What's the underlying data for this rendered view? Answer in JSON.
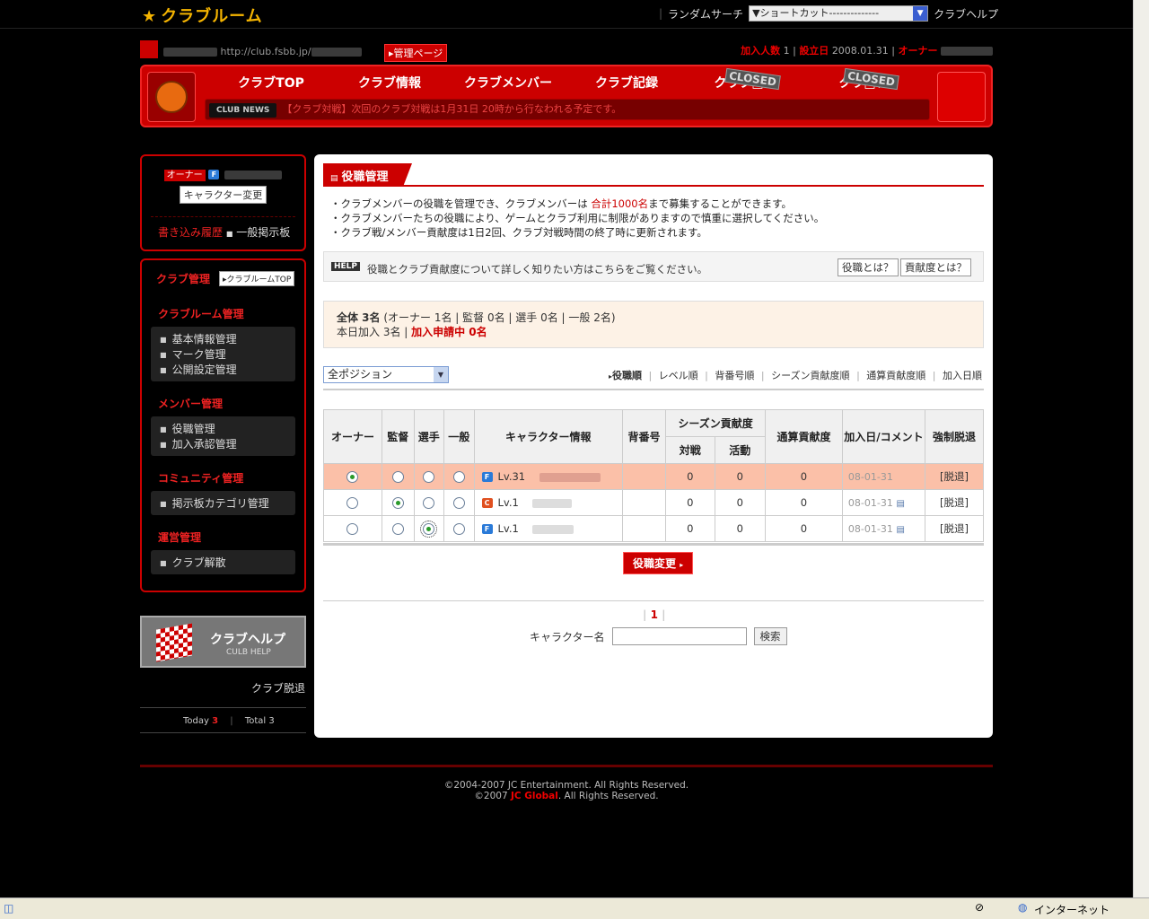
{
  "header": {
    "logo": "クラブルーム",
    "random_search": "ランダムサーチ",
    "shortcut": "▼ショートカット--------------",
    "club_help": "クラブヘルプ"
  },
  "club": {
    "url": "http://club.fsbb.jp/",
    "admin_page": "管理ページ",
    "members_label": "加入人数",
    "members": "1",
    "founded_label": "設立日",
    "founded": "2008.01.31",
    "owner_label": "オーナー"
  },
  "nav": {
    "tabs": [
      "クラブTOP",
      "クラブ情報",
      "クラブメンバー",
      "クラブ記録",
      "クラブ□ム",
      "クラ□ク"
    ],
    "closed": "CLOSED",
    "news_tag": "CLUB NEWS",
    "news": "【クラブ対戦】次回のクラブ対戦は1月31日 20時から行なわれる予定です。"
  },
  "sidebar": {
    "owner_badge": "オーナー",
    "char_change": "キャラクター変更",
    "write_history": "書き込み履歴",
    "board": "一般掲示板",
    "club_admin": "クラブ管理",
    "room_top": "クラブルームTOP",
    "sections": [
      {
        "title": "クラブルーム管理",
        "items": [
          "基本情報管理",
          "マーク管理",
          "公開設定管理"
        ]
      },
      {
        "title": "メンバー管理",
        "items": [
          "役職管理",
          "加入承認管理"
        ]
      },
      {
        "title": "コミュニティ管理",
        "items": [
          "掲示板カテゴリ管理"
        ]
      },
      {
        "title": "運営管理",
        "items": [
          "クラブ解散"
        ]
      }
    ],
    "help_title": "クラブヘルプ",
    "help_sub": "CULB HELP",
    "leave": "クラブ脱退",
    "today_label": "Today",
    "today": "3",
    "total_label": "Total",
    "total": "3"
  },
  "main": {
    "title": "役職管理",
    "desc": [
      "・クラブメンバーの役職を管理でき、クラブメンバーは",
      "合計1000名",
      "まで募集することができます。",
      "・クラブメンバーたちの役職により、ゲームとクラブ利用に制限がありますので慎重に選択してください。",
      "・クラブ戦/メンバー貢献度は1日2回、クラブ対戦時間の終了時に更新されます。"
    ],
    "help_badge": "HELP",
    "help_text": "役職とクラブ貢献度について詳しく知りたい方はこちらをご覧ください。",
    "btn_role": "役職とは？",
    "btn_contrib": "貢献度とは？",
    "count_total": "全体 3名",
    "count_detail": "(オーナー 1名 | 監督 0名 | 選手 0名 | 一般 2名)",
    "today_join": "本日加入 3名 | ",
    "pending": "加入申請中 0名",
    "position_select": "全ポジション",
    "sorts": [
      "役職順",
      "レベル順",
      "背番号順",
      "シーズン貢献度順",
      "通算貢献度順",
      "加入日順"
    ],
    "columns": [
      "オーナー",
      "監督",
      "選手",
      "一般",
      "キャラクター情報",
      "背番号",
      "シーズン貢献度",
      "対戦",
      "活動",
      "通算貢献度",
      "加入日/コメント",
      "強制脱退"
    ],
    "rows": [
      {
        "level": "Lv.31",
        "num": "",
        "battle": "0",
        "activity": "0",
        "total": "0",
        "date": "08-01-31",
        "kick": "[脱退]",
        "role": 0,
        "icon": "F"
      },
      {
        "level": "Lv.1",
        "num": "",
        "battle": "0",
        "activity": "0",
        "total": "0",
        "date": "08-01-31",
        "kick": "[脱退]",
        "role": 1,
        "icon": "C"
      },
      {
        "level": "Lv.1",
        "num": "",
        "battle": "0",
        "activity": "0",
        "total": "0",
        "date": "08-01-31",
        "kick": "[脱退]",
        "role": 2,
        "icon": "F"
      }
    ],
    "change_btn": "役職変更",
    "page": "1",
    "search_label": "キャラクター名",
    "search_btn": "検索"
  },
  "footer": {
    "line1": "©2004-2007 JC Entertainment. All Rights Reserved.",
    "line2a": "©2007 ",
    "line2b": "JC Global",
    "line2c": ". All Rights Reserved."
  },
  "status": {
    "zone": "インターネット"
  },
  "colors": {
    "accent": "#cc0000",
    "logo": "#f5b400",
    "highlight_row": "#fbc0a8"
  }
}
